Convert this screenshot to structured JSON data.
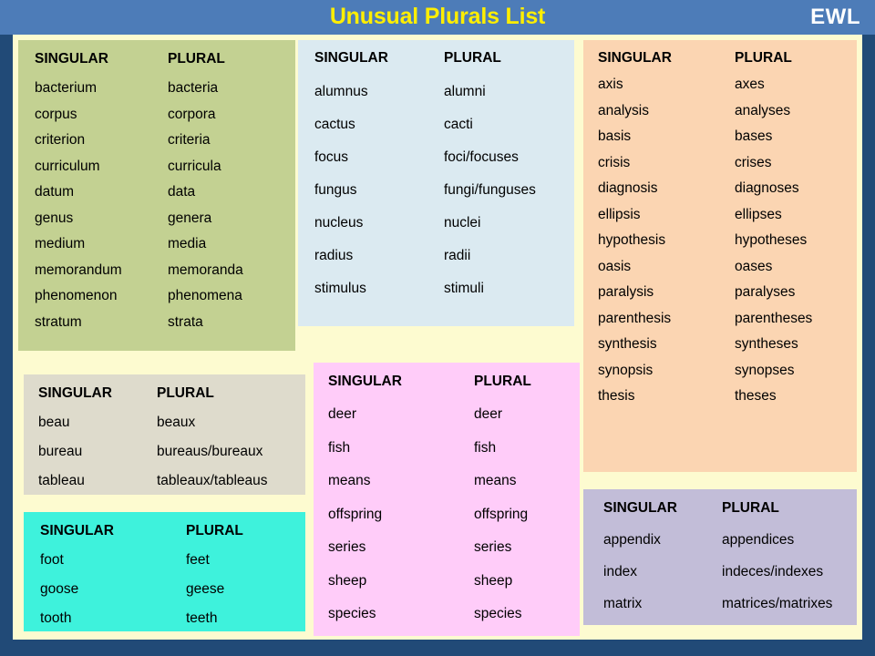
{
  "header": {
    "title": "Unusual Plurals List",
    "logo": "EWL",
    "bg_color": "#4d7cb8",
    "title_color": "#ffee00",
    "logo_color": "#ffffff"
  },
  "slide": {
    "border_color": "#214a77",
    "canvas_color": "#fdfbd0"
  },
  "columns": {
    "singular": "SINGULAR",
    "plural": "PLURAL"
  },
  "tables": [
    {
      "id": "latin-um",
      "bg_color": "#c3d192",
      "headers": [
        "SINGULAR",
        "PLURAL"
      ],
      "rows": [
        [
          "bacterium",
          "bacteria"
        ],
        [
          "corpus",
          "corpora"
        ],
        [
          "criterion",
          "criteria"
        ],
        [
          "curriculum",
          "curricula"
        ],
        [
          "datum",
          "data"
        ],
        [
          "genus",
          "genera"
        ],
        [
          "medium",
          "media"
        ],
        [
          "memorandum",
          "memoranda"
        ],
        [
          "phenomenon",
          "phenomena"
        ],
        [
          "stratum",
          "strata"
        ]
      ]
    },
    {
      "id": "latin-us",
      "bg_color": "#dbeaf1",
      "headers": [
        "SINGULAR",
        "PLURAL"
      ],
      "rows": [
        [
          "alumnus",
          "alumni"
        ],
        [
          "cactus",
          "cacti"
        ],
        [
          "focus",
          "foci/focuses"
        ],
        [
          "fungus",
          "fungi/funguses"
        ],
        [
          "nucleus",
          "nuclei"
        ],
        [
          "radius",
          "radii"
        ],
        [
          "stimulus",
          "stimuli"
        ]
      ]
    },
    {
      "id": "greek-is",
      "bg_color": "#fbd5b2",
      "headers": [
        "SINGULAR",
        "PLURAL"
      ],
      "rows": [
        [
          "axis",
          "axes"
        ],
        [
          "analysis",
          "analyses"
        ],
        [
          "basis",
          "bases"
        ],
        [
          "crisis",
          "crises"
        ],
        [
          "diagnosis",
          "diagnoses"
        ],
        [
          "ellipsis",
          "ellipses"
        ],
        [
          "hypothesis",
          "hypotheses"
        ],
        [
          "oasis",
          "oases"
        ],
        [
          "paralysis",
          "paralyses"
        ],
        [
          "parenthesis",
          "parentheses"
        ],
        [
          "synthesis",
          "syntheses"
        ],
        [
          "synopsis",
          "synopses"
        ],
        [
          "thesis",
          "theses"
        ]
      ]
    },
    {
      "id": "french-eau",
      "bg_color": "#dedbcc",
      "headers": [
        "SINGULAR",
        "PLURAL"
      ],
      "rows": [
        [
          "beau",
          "beaux"
        ],
        [
          "bureau",
          "bureaus/bureaux"
        ],
        [
          "tableau",
          "tableaux/tableaus"
        ]
      ]
    },
    {
      "id": "unchanging",
      "bg_color": "#ffccf9",
      "headers": [
        "SINGULAR",
        "PLURAL"
      ],
      "rows": [
        [
          "deer",
          "deer"
        ],
        [
          "fish",
          "fish"
        ],
        [
          "means",
          "means"
        ],
        [
          "offspring",
          "offspring"
        ],
        [
          "series",
          "series"
        ],
        [
          "sheep",
          "sheep"
        ],
        [
          "species",
          "species"
        ]
      ]
    },
    {
      "id": "latin-ix",
      "bg_color": "#c2bdd8",
      "headers": [
        "SINGULAR",
        "PLURAL"
      ],
      "rows": [
        [
          "appendix",
          "appendices"
        ],
        [
          "index",
          "indeces/indexes"
        ],
        [
          "matrix",
          "matrices/matrixes"
        ]
      ]
    },
    {
      "id": "vowel-change",
      "bg_color": "#3ef2dc",
      "headers": [
        "SINGULAR",
        "PLURAL"
      ],
      "rows": [
        [
          "foot",
          "feet"
        ],
        [
          "goose",
          "geese"
        ],
        [
          "tooth",
          "teeth"
        ]
      ]
    }
  ]
}
